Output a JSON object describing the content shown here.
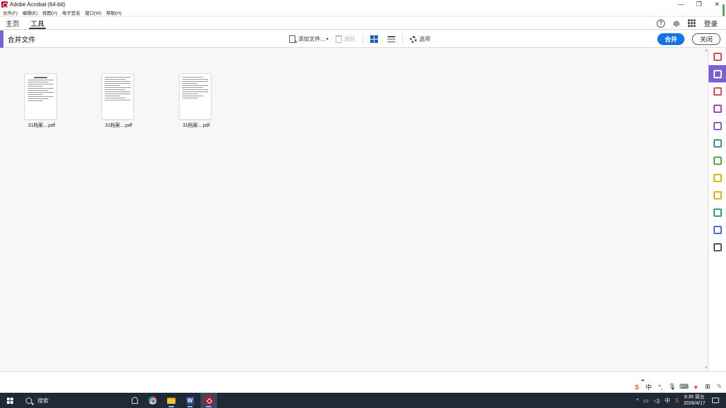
{
  "window": {
    "title": "Adobe Acrobat (64-bit)",
    "controls": {
      "minimize": "—",
      "restore": "❐",
      "close": "✕"
    }
  },
  "menu": [
    "文件(F)",
    "编辑(E)",
    "视图(V)",
    "电子签名",
    "窗口(W)",
    "帮助(H)"
  ],
  "nav": {
    "tabs": [
      {
        "label": "主页",
        "active": false
      },
      {
        "label": "工具",
        "active": true
      }
    ],
    "help_glyph": "?",
    "signin": "登录"
  },
  "toolbar": {
    "title": "合并文件",
    "add_files": "添加文件...",
    "add_files_caret": "▾",
    "delete": "删除",
    "options": "选项",
    "merge": "合并",
    "close": "关闭"
  },
  "files": [
    {
      "name": "31档案....pdf"
    },
    {
      "name": "31档案....pdf"
    },
    {
      "name": "31档案....pdf"
    }
  ],
  "scroll": {
    "up": "▲",
    "down": "▼"
  },
  "rail_tools": [
    {
      "icon": "export-pdf-icon",
      "color": "#e34850"
    },
    {
      "icon": "combine-files-icon",
      "color": "#ffffff",
      "active": true
    },
    {
      "icon": "organize-pages-icon",
      "color": "#e34850"
    },
    {
      "icon": "request-signature-icon",
      "color": "#b03cc8"
    },
    {
      "icon": "fill-sign-icon",
      "color": "#7b61d8"
    },
    {
      "icon": "edit-pdf-icon",
      "color": "#2d9d78"
    },
    {
      "icon": "create-pdf-icon",
      "color": "#5ba84c"
    },
    {
      "icon": "send-review-icon",
      "color": "#e8b100"
    },
    {
      "icon": "comment-icon",
      "color": "#e8b100"
    },
    {
      "icon": "print-production-icon",
      "color": "#2d9d78"
    },
    {
      "icon": "protect-icon",
      "color": "#3d6fd8"
    },
    {
      "icon": "more-tools-icon",
      "color": "#555555"
    }
  ],
  "ime": {
    "lang": "中",
    "dots": "°,",
    "grid": "⊞"
  },
  "taskbar": {
    "search": "搜索",
    "tray": {
      "caret": "^",
      "lang": "中",
      "time": "9:35 周五",
      "date": "2026/4/17"
    }
  }
}
